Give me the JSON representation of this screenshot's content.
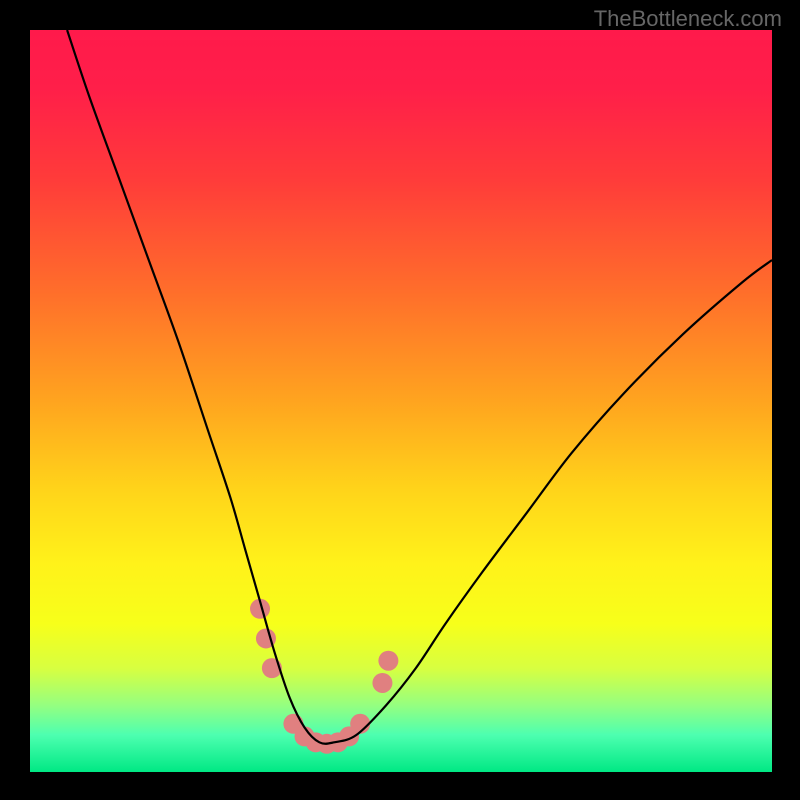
{
  "watermark": "TheBottleneck.com",
  "gradient": {
    "stops": [
      {
        "offset": 0.0,
        "color": "#ff1a4b"
      },
      {
        "offset": 0.08,
        "color": "#ff1f49"
      },
      {
        "offset": 0.2,
        "color": "#ff3b3a"
      },
      {
        "offset": 0.35,
        "color": "#ff6d2b"
      },
      {
        "offset": 0.5,
        "color": "#ffa41f"
      },
      {
        "offset": 0.62,
        "color": "#ffd41a"
      },
      {
        "offset": 0.72,
        "color": "#fff21a"
      },
      {
        "offset": 0.8,
        "color": "#f7ff1a"
      },
      {
        "offset": 0.86,
        "color": "#d8ff40"
      },
      {
        "offset": 0.91,
        "color": "#95ff80"
      },
      {
        "offset": 0.95,
        "color": "#4dffb0"
      },
      {
        "offset": 1.0,
        "color": "#00e884"
      }
    ]
  },
  "chart_data": {
    "type": "line",
    "title": "",
    "xlabel": "",
    "ylabel": "",
    "xlim": [
      0,
      100
    ],
    "ylim": [
      0,
      100
    ],
    "series": [
      {
        "name": "bottleneck-curve",
        "color": "#000000",
        "x": [
          5,
          8,
          12,
          16,
          20,
          24,
          27,
          29,
          31,
          33,
          35,
          37,
          39,
          41,
          44,
          48,
          52,
          56,
          61,
          67,
          73,
          80,
          88,
          96,
          100
        ],
        "y": [
          100,
          91,
          80,
          69,
          58,
          46,
          37,
          30,
          23,
          16,
          10,
          6,
          4,
          4,
          5,
          9,
          14,
          20,
          27,
          35,
          43,
          51,
          59,
          66,
          69
        ]
      }
    ],
    "markers": {
      "name": "highlight-dots",
      "color": "#e08080",
      "points": [
        {
          "x": 31.0,
          "y": 22
        },
        {
          "x": 31.8,
          "y": 18
        },
        {
          "x": 32.6,
          "y": 14
        },
        {
          "x": 35.5,
          "y": 6.5
        },
        {
          "x": 37.0,
          "y": 4.8
        },
        {
          "x": 38.5,
          "y": 4.0
        },
        {
          "x": 40.0,
          "y": 3.8
        },
        {
          "x": 41.5,
          "y": 4.0
        },
        {
          "x": 43.0,
          "y": 4.8
        },
        {
          "x": 44.5,
          "y": 6.5
        },
        {
          "x": 47.5,
          "y": 12
        },
        {
          "x": 48.3,
          "y": 15
        }
      ]
    }
  }
}
